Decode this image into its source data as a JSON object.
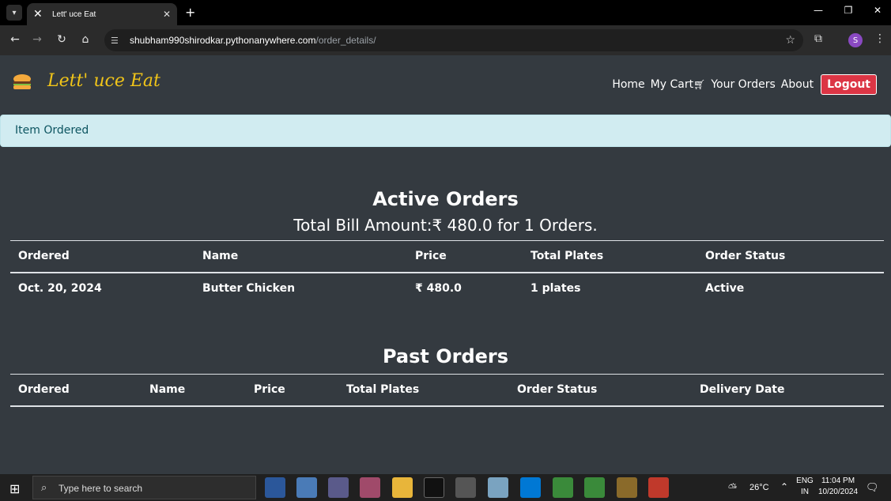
{
  "browser": {
    "tab_title": "Lett' uce Eat",
    "url_host": "shubham990shirodkar.pythonanywhere.com",
    "url_path": "/order_details/",
    "profile_initial": "S"
  },
  "navbar": {
    "brand": "Lett' uce Eat",
    "links": [
      "Home",
      "My Cart",
      "Your Orders",
      "About"
    ],
    "logout": "Logout"
  },
  "alert": "Item Ordered",
  "active_orders": {
    "heading": "Active Orders",
    "total": "Total Bill Amount:₹ 480.0 for 1 Orders.",
    "columns": [
      "Ordered",
      "Name",
      "Price",
      "Total Plates",
      "Order Status"
    ],
    "rows": [
      [
        "Oct. 20, 2024",
        "Butter Chicken",
        "₹ 480.0",
        "1 plates",
        "Active"
      ]
    ]
  },
  "past_orders": {
    "heading": "Past Orders",
    "columns": [
      "Ordered",
      "Name",
      "Price",
      "Total Plates",
      "Order Status",
      "Delivery Date"
    ]
  },
  "taskbar": {
    "search_placeholder": "Type here to search",
    "weather": "26°C",
    "lang_line1": "ENG",
    "lang_line2": "IN",
    "time": "11:04 PM",
    "date": "10/20/2024"
  }
}
